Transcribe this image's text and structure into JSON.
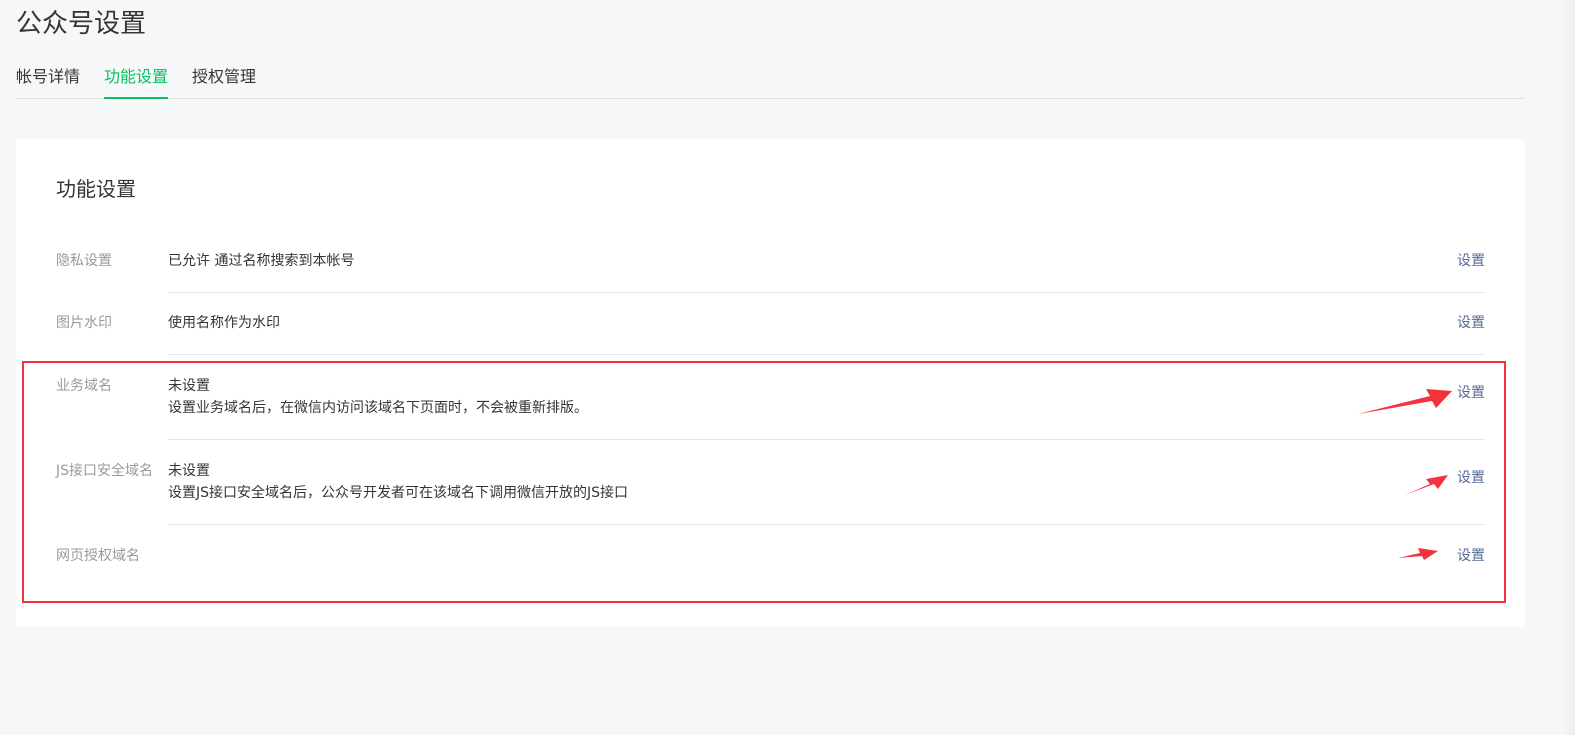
{
  "page": {
    "title": "公众号设置"
  },
  "tabs": [
    {
      "label": "帐号详情",
      "active": false
    },
    {
      "label": "功能设置",
      "active": true
    },
    {
      "label": "授权管理",
      "active": false
    }
  ],
  "card": {
    "title": "功能设置",
    "rows": [
      {
        "label": "隐私设置",
        "value_line1": "已允许 通过名称搜索到本帐号",
        "value_line2": "",
        "action": "设置"
      },
      {
        "label": "图片水印",
        "value_line1": "使用名称作为水印",
        "value_line2": "",
        "action": "设置"
      },
      {
        "label": "业务域名",
        "value_line1": "未设置",
        "value_line2": "设置业务域名后，在微信内访问该域名下页面时，不会被重新排版。",
        "action": "设置"
      },
      {
        "label": "JS接口安全域名",
        "value_line1": "未设置",
        "value_line2": "设置JS接口安全域名后，公众号开发者可在该域名下调用微信开放的JS接口",
        "action": "设置"
      },
      {
        "label": "网页授权域名",
        "value_line1": "",
        "value_line2": "",
        "action": "设置"
      }
    ]
  },
  "annotations": {
    "highlight_color": "#f2323c",
    "accent_color": "#07c160",
    "link_color": "#576b95"
  }
}
